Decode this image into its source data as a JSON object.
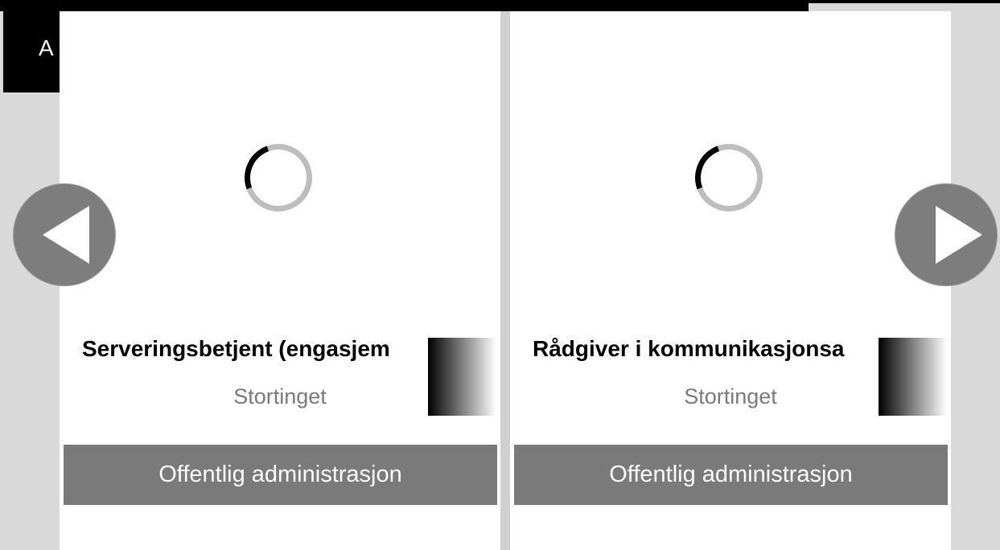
{
  "header": {
    "partial_label": "A"
  },
  "cards": [
    {
      "title": "Serveringsbetjent (engasjem",
      "employer": "Stortinget",
      "category": "Offentlig administrasjon"
    },
    {
      "title": "Rådgiver i kommunikasjonsa",
      "employer": "Stortinget",
      "category": "Offentlig administrasjon"
    }
  ],
  "carousel": {
    "prev_icon": "chevron-left-icon",
    "next_icon": "chevron-right-icon"
  }
}
